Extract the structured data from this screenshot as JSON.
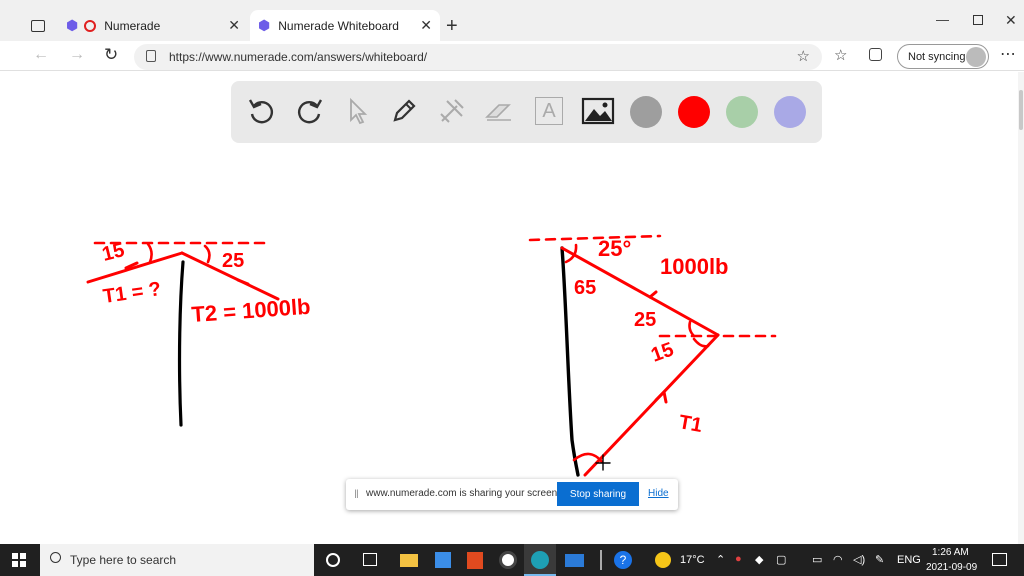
{
  "browser": {
    "tabs": [
      {
        "label": "Numerade",
        "active": false
      },
      {
        "label": "Numerade Whiteboard",
        "active": true
      }
    ],
    "url": "https://www.numerade.com/answers/whiteboard/",
    "sync_label": "Not syncing"
  },
  "whiteboard": {
    "tools": [
      "undo-icon",
      "redo-icon",
      "pointer-icon",
      "pen-icon",
      "tools-icon",
      "eraser-icon",
      "text-icon",
      "image-icon"
    ],
    "text_tool_label": "A",
    "colors": [
      "#9e9e9e",
      "#ff0000",
      "#a8cfa8",
      "#a9a9e6"
    ],
    "drawing": {
      "left": {
        "angle1": "15",
        "angle2": "25",
        "t1": "T1 = ?",
        "t2": "T2 = 1000lb"
      },
      "right": {
        "top_angle": "25°",
        "weight": "1000lb",
        "a65": "65",
        "a25": "25",
        "a15": "15",
        "t1": "T1"
      }
    }
  },
  "share_banner": {
    "message": "www.numerade.com is sharing your screen.",
    "stop_label": "Stop sharing",
    "hide_label": "Hide"
  },
  "taskbar": {
    "search_placeholder": "Type here to search",
    "weather": "17°C",
    "language": "ENG",
    "time": "1:26 AM",
    "date": "2021-09-09"
  }
}
